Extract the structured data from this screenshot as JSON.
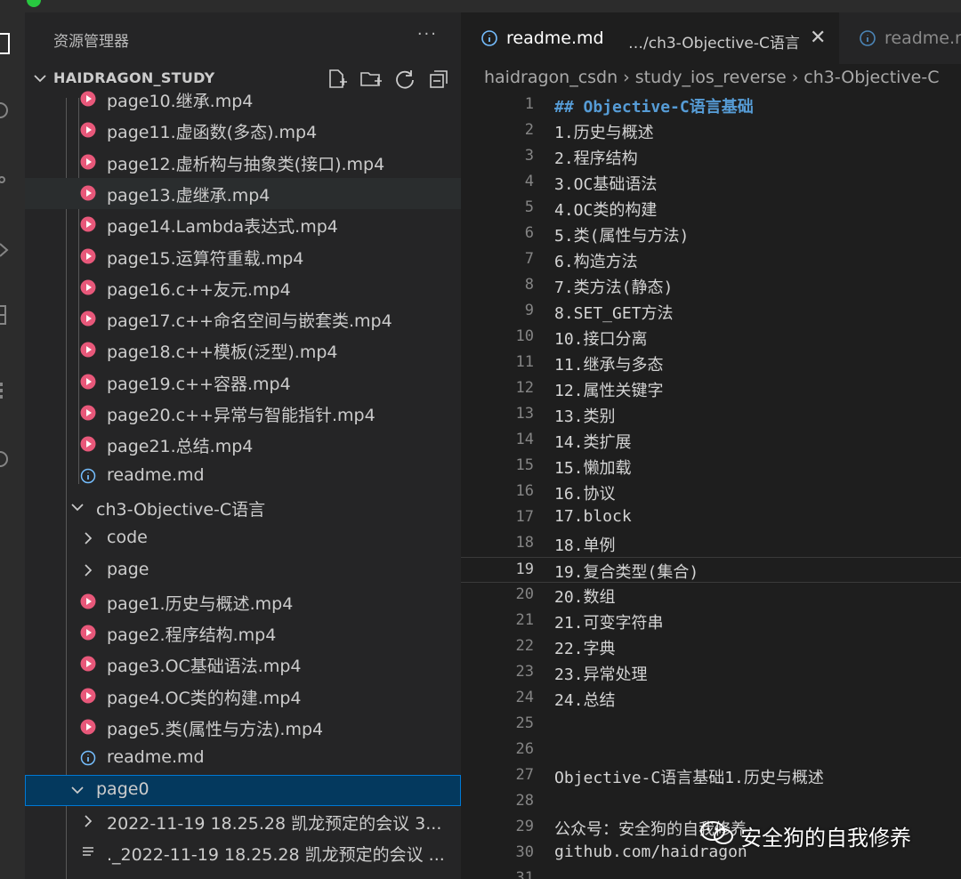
{
  "sidebar": {
    "title": "资源管理器",
    "more": "···",
    "section": "HAIDRAGON_STUDY",
    "items": [
      {
        "label": "page10.继承.mp4",
        "type": "video"
      },
      {
        "label": "page11.虚函数(多态).mp4",
        "type": "video"
      },
      {
        "label": "page12.虚析构与抽象类(接口).mp4",
        "type": "video"
      },
      {
        "label": "page13.虚继承.mp4",
        "type": "video"
      },
      {
        "label": "page14.Lambda表达式.mp4",
        "type": "video"
      },
      {
        "label": "page15.运算符重载.mp4",
        "type": "video"
      },
      {
        "label": "page16.c++友元.mp4",
        "type": "video"
      },
      {
        "label": "page17.c++命名空间与嵌套类.mp4",
        "type": "video"
      },
      {
        "label": "page18.c++模板(泛型).mp4",
        "type": "video"
      },
      {
        "label": "page19.c++容器.mp4",
        "type": "video"
      },
      {
        "label": "page20.c++异常与智能指针.mp4",
        "type": "video"
      },
      {
        "label": "page21.总结.mp4",
        "type": "video"
      },
      {
        "label": "readme.md",
        "type": "info"
      },
      {
        "label": "ch3-Objective-C语言",
        "type": "folder-open"
      },
      {
        "label": "code",
        "type": "folder-closed"
      },
      {
        "label": "page",
        "type": "folder-closed"
      },
      {
        "label": "page1.历史与概述.mp4",
        "type": "video"
      },
      {
        "label": "page2.程序结构.mp4",
        "type": "video"
      },
      {
        "label": "page3.OC基础语法.mp4",
        "type": "video"
      },
      {
        "label": "page4.OC类的构建.mp4",
        "type": "video"
      },
      {
        "label": "page5.类(属性与方法).mp4",
        "type": "video"
      },
      {
        "label": "readme.md",
        "type": "info"
      },
      {
        "label": "page0",
        "type": "folder-open"
      },
      {
        "label": "2022-11-19 18.25.28 凯龙预定的会议 3...",
        "type": "folder-closed"
      },
      {
        "label": "._2022-11-19 18.25.28 凯龙预定的会议 ...",
        "type": "text"
      }
    ]
  },
  "tabs": [
    {
      "name": "readme.md",
      "path": "…/ch3-Objective-C语言",
      "close": "✕"
    },
    {
      "name": "readme.m"
    }
  ],
  "breadcrumb": [
    "haidragon_csdn",
    "study_ios_reverse",
    "ch3-Objective-C"
  ],
  "editor": {
    "current_line": 19,
    "lines": [
      {
        "n": "1",
        "t": "## Objective-C语言基础"
      },
      {
        "n": "2",
        "t": "1.历史与概述"
      },
      {
        "n": "3",
        "t": "2.程序结构"
      },
      {
        "n": "4",
        "t": "3.OC基础语法"
      },
      {
        "n": "5",
        "t": "4.OC类的构建"
      },
      {
        "n": "6",
        "t": "5.类(属性与方法)"
      },
      {
        "n": "7",
        "t": "6.构造方法"
      },
      {
        "n": "8",
        "t": "7.类方法(静态)"
      },
      {
        "n": "9",
        "t": "8.SET_GET方法"
      },
      {
        "n": "10",
        "t": "10.接口分离"
      },
      {
        "n": "11",
        "t": "11.继承与多态"
      },
      {
        "n": "12",
        "t": "12.属性关键字"
      },
      {
        "n": "13",
        "t": "13.类别"
      },
      {
        "n": "14",
        "t": "14.类扩展"
      },
      {
        "n": "15",
        "t": "15.懒加载"
      },
      {
        "n": "16",
        "t": "16.协议"
      },
      {
        "n": "17",
        "t": "17.block"
      },
      {
        "n": "18",
        "t": "18.单例"
      },
      {
        "n": "19",
        "t": "19.复合类型(集合)"
      },
      {
        "n": "20",
        "t": "20.数组"
      },
      {
        "n": "21",
        "t": "21.可变字符串"
      },
      {
        "n": "22",
        "t": "22.字典"
      },
      {
        "n": "23",
        "t": "23.异常处理"
      },
      {
        "n": "24",
        "t": "24.总结"
      },
      {
        "n": "25",
        "t": ""
      },
      {
        "n": "26",
        "t": ""
      },
      {
        "n": "27",
        "t": "Objective-C语言基础1.历史与概述"
      },
      {
        "n": "28",
        "t": ""
      },
      {
        "n": "29",
        "t": "公众号：安全狗的自我修养"
      },
      {
        "n": "30",
        "t": "github.com/haidragon"
      },
      {
        "n": "31",
        "t": ""
      }
    ]
  },
  "watermark": "安全狗的自我修养",
  "colors": {
    "video_icon": "#e8587a",
    "heading": "#569cd6",
    "selection": "#04395e",
    "focus": "#0078d4"
  }
}
